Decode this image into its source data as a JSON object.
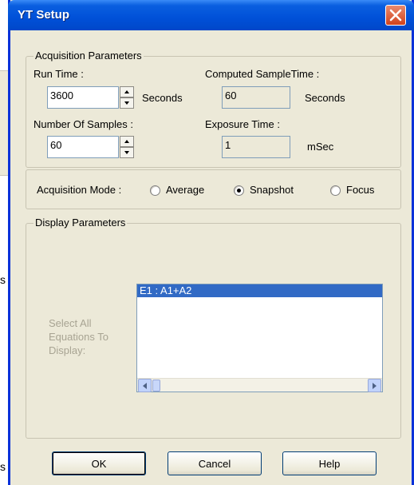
{
  "background": {
    "fragment_a": "s",
    "fragment_b": "s"
  },
  "dialog": {
    "title": "YT Setup",
    "acquisition": {
      "legend": "Acquisition Parameters",
      "run_time_label": "Run Time :",
      "run_time_value": "3600",
      "run_time_unit": "Seconds",
      "computed_label": "Computed SampleTime :",
      "computed_value": "60",
      "computed_unit": "Seconds",
      "samples_label": "Number Of Samples :",
      "samples_value": "60",
      "exposure_label": "Exposure Time :",
      "exposure_value": "1",
      "exposure_unit": "mSec"
    },
    "mode": {
      "label": "Acquisition Mode :",
      "options": [
        "Average",
        "Snapshot",
        "Focus"
      ],
      "selected": "Snapshot"
    },
    "display": {
      "legend": "Display Parameters",
      "hint_line1": "Select All",
      "hint_line2": "Equations To",
      "hint_line3": "Display:",
      "equations": [
        "E1 : A1+A2"
      ]
    },
    "buttons": {
      "ok": "OK",
      "cancel": "Cancel",
      "help": "Help"
    }
  },
  "colors": {
    "titlebar": "#0050d8",
    "close": "#d2421c",
    "selection": "#316ac5",
    "face": "#ece9d8"
  }
}
